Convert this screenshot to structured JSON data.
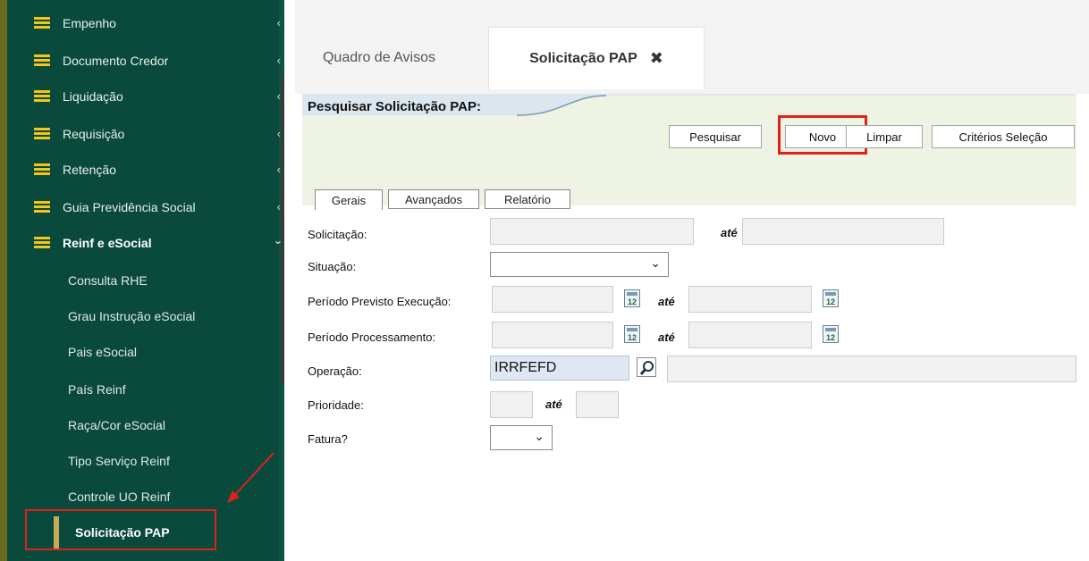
{
  "sidebar": {
    "items": [
      {
        "label": "Empenho"
      },
      {
        "label": "Documento Credor"
      },
      {
        "label": "Liquidação"
      },
      {
        "label": "Requisição"
      },
      {
        "label": "Retenção"
      },
      {
        "label": "Guia Previdência Social"
      },
      {
        "label": "Reinf e eSocial"
      }
    ],
    "subitems": [
      {
        "label": "Consulta RHE"
      },
      {
        "label": "Grau Instrução eSocial"
      },
      {
        "label": "Pais eSocial"
      },
      {
        "label": "País Reinf"
      },
      {
        "label": "Raça/Cor eSocial"
      },
      {
        "label": "Tipo Serviço Reinf"
      },
      {
        "label": "Controle UO Reinf"
      },
      {
        "label": "Solicitação PAP"
      }
    ]
  },
  "tabs": {
    "avisos": "Quadro de Avisos",
    "solicitacao": "Solicitação PAP"
  },
  "panel": {
    "title": "Pesquisar Solicitação PAP:",
    "buttons": {
      "pesquisar": "Pesquisar",
      "novo": "Novo",
      "limpar": "Limpar",
      "criterios": "Critérios Seleção"
    },
    "subtabs": {
      "gerais": "Gerais",
      "avancados": "Avançados",
      "relatorio": "Relatório"
    }
  },
  "form": {
    "solicitacao": "Solicitação:",
    "situacao": "Situação:",
    "periodo_previsto": "Período Previsto Execução:",
    "periodo_processamento": "Período Processamento:",
    "operacao": "Operação:",
    "operacao_value": "IRRFEFD",
    "prioridade": "Prioridade:",
    "fatura": "Fatura?",
    "ate": "até",
    "cal_day": "12"
  },
  "colors": {
    "sidebar_bg": "#0a4a3c",
    "icon_yellow": "#f5c518",
    "highlight_red": "#e0201a",
    "panel_bg": "#eef3e3"
  }
}
